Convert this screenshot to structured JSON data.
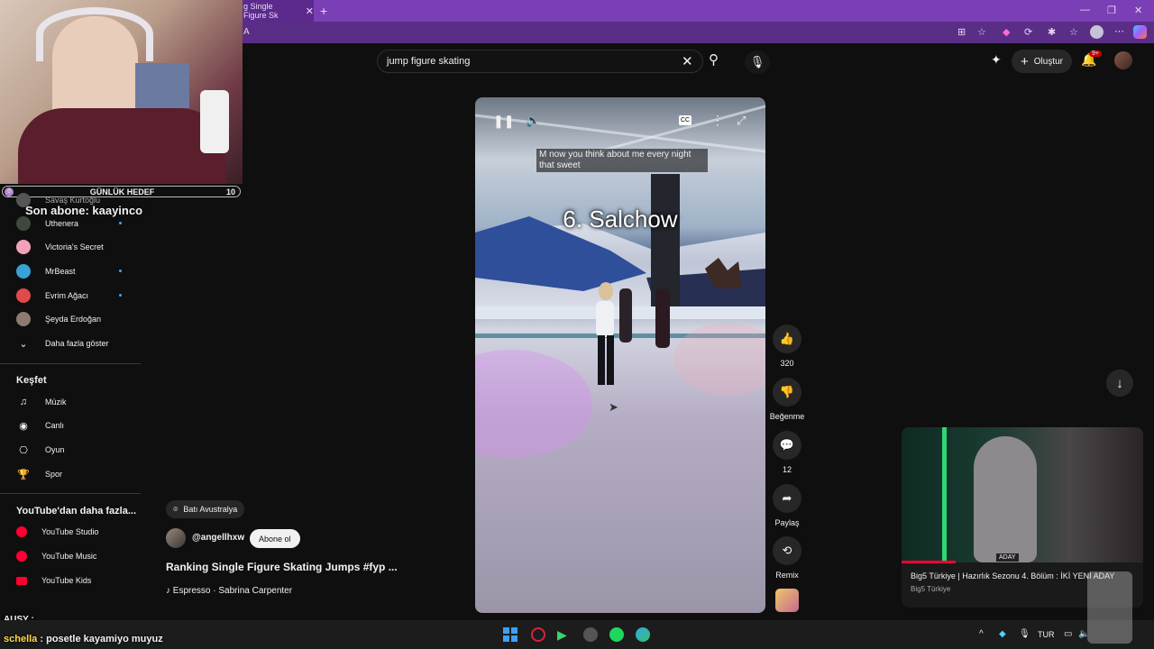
{
  "browser": {
    "tab_title": "g Single Figure Sk",
    "address_fragment": "A"
  },
  "header": {
    "search_value": "jump figure skating",
    "create_label": "Oluştur",
    "notif_badge": "9+"
  },
  "overlay": {
    "goal_label": "GÜNLÜK HEDEF",
    "goal_value": "10",
    "goal_start": "0",
    "last_sub": "Son abone: kaayinco",
    "chat": [
      {
        "user": "AUSY",
        "text": ":"
      },
      {
        "user": "schella",
        "text": ": posetle kayamiyo muyuz"
      }
    ]
  },
  "sidebar": {
    "subs": [
      {
        "label": "Savaş Kurtoğlu"
      },
      {
        "label": "Uthenera"
      },
      {
        "label": "Victoria's Secret"
      },
      {
        "label": "MrBeast"
      },
      {
        "label": "Evrim Ağacı"
      },
      {
        "label": "Şeyda Erdoğan"
      }
    ],
    "show_more": "Daha fazla göster",
    "explore_title": "Keşfet",
    "explore": [
      {
        "label": "Müzik"
      },
      {
        "label": "Canlı"
      },
      {
        "label": "Oyun"
      },
      {
        "label": "Spor"
      }
    ],
    "more_title": "YouTube'dan daha fazla...",
    "more": [
      {
        "label": "YouTube Studio"
      },
      {
        "label": "YouTube Music"
      },
      {
        "label": "YouTube Kids"
      }
    ]
  },
  "short": {
    "location": "Batı Avustralya",
    "channel": "@angellhxw",
    "subscribe": "Abone ol",
    "title": "Ranking Single Figure Skating Jumps #fyp ...",
    "music": "♪ Espresso · Sabrina Carpenter",
    "caption": "M now you think about me every night that sweet",
    "overlay_title": "6. Salchow",
    "likes": "320",
    "dislike_label": "Beğenme",
    "comments": "12",
    "share_label": "Paylaş",
    "remix_label": "Remix"
  },
  "miniplayer": {
    "title": "Big5 Türkiye | Hazırlık Sezonu 4. Bölüm : İKİ YENİ ADAY",
    "channel": "Big5 Türkiye",
    "badge": "ADAY"
  },
  "taskbar": {
    "lang": "TUR"
  },
  "colors": {
    "accent_red": "#ff0033",
    "browser_purple": "#7b3fb5",
    "link_blue": "#3ea6ff"
  }
}
